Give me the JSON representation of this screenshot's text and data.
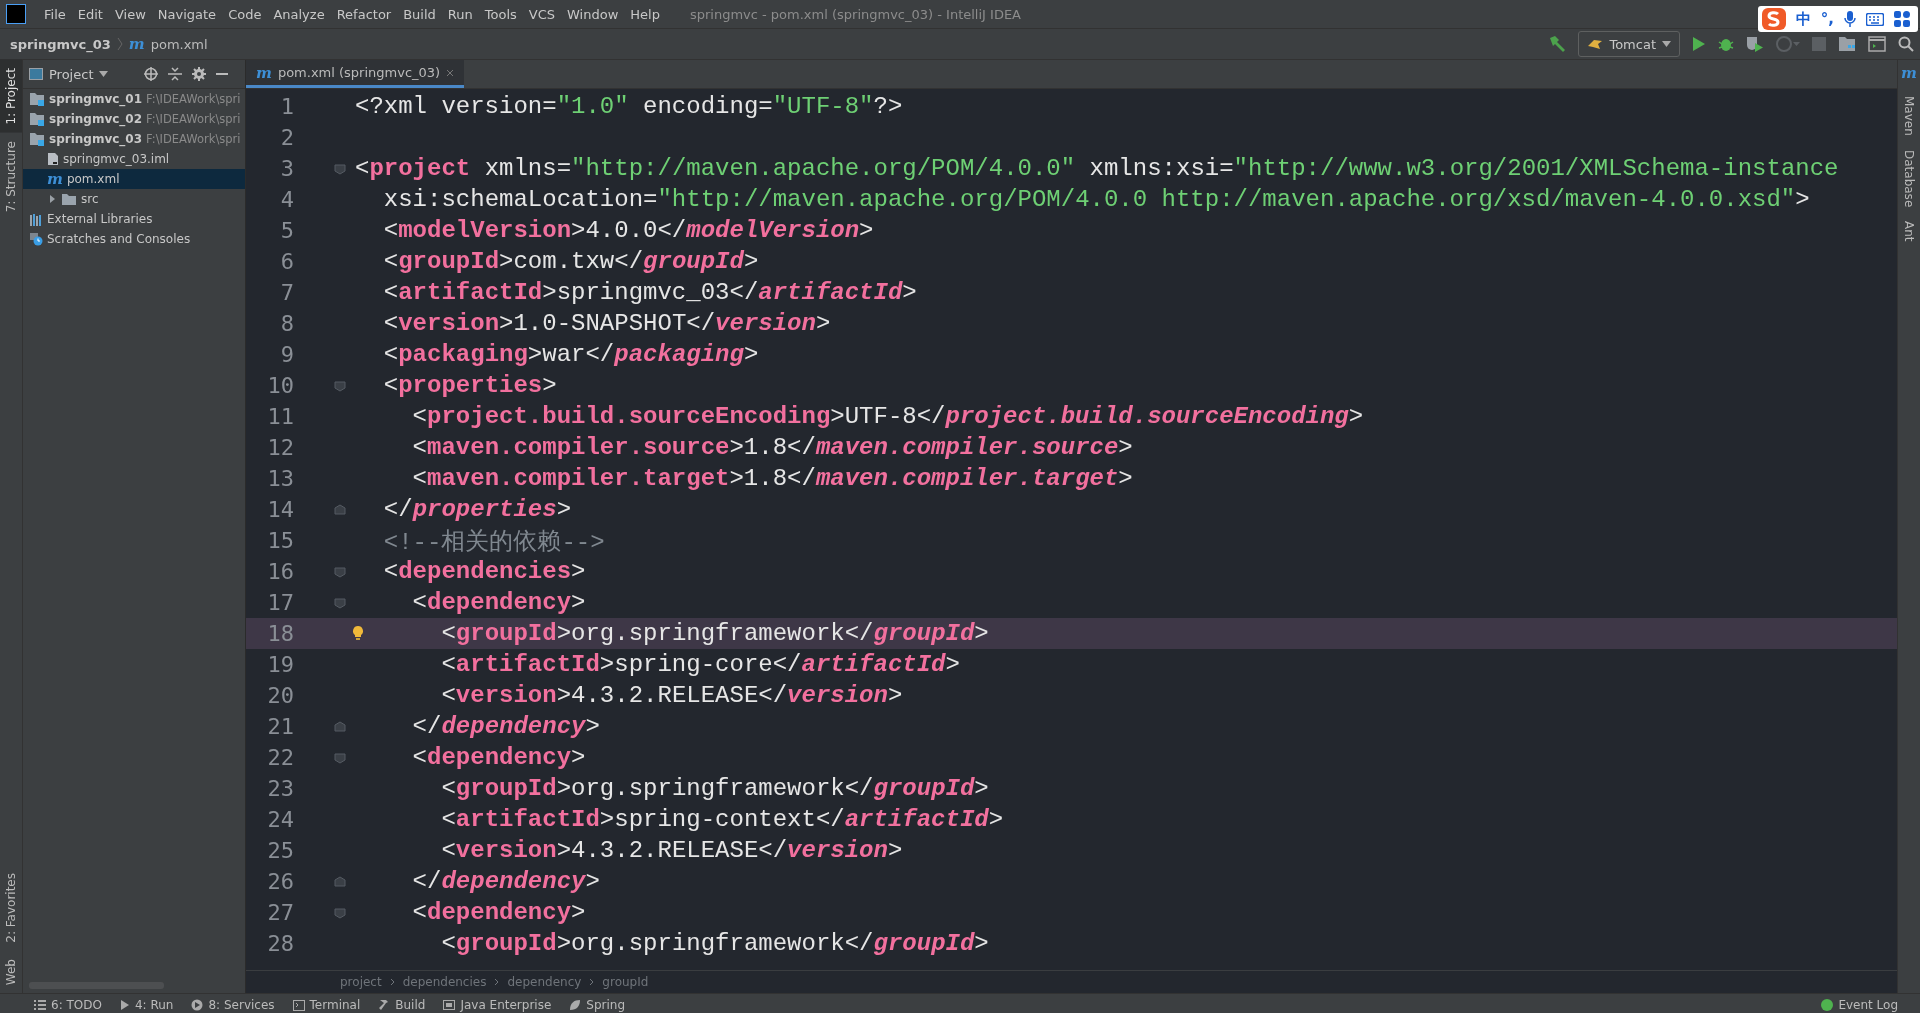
{
  "menu": [
    "File",
    "Edit",
    "View",
    "Navigate",
    "Code",
    "Analyze",
    "Refactor",
    "Build",
    "Run",
    "Tools",
    "VCS",
    "Window",
    "Help"
  ],
  "window": {
    "title": "springmvc - pom.xml (springmvc_03) - IntelliJ IDEA"
  },
  "navbar": {
    "project": "springmvc_03",
    "file_badge": "m",
    "file": "pom.xml"
  },
  "run_config": {
    "label": "Tomcat"
  },
  "ime": {
    "items": [
      "中",
      "°,"
    ]
  },
  "left_strip": {
    "top": [
      {
        "label": "1: Project",
        "selected": true
      },
      {
        "label": "7: Structure",
        "selected": false
      }
    ],
    "bottom": [
      {
        "label": "2: Favorites",
        "selected": false
      },
      {
        "label": "Web",
        "selected": false
      }
    ]
  },
  "right_strip": {
    "badge": "m",
    "tabs": [
      "Maven",
      "Database",
      "Ant"
    ]
  },
  "project_panel": {
    "title": "Project",
    "tree": [
      {
        "kind": "module",
        "label": "springmvc_01",
        "path": "F:\\IDEAWork\\spri",
        "selected": false
      },
      {
        "kind": "module",
        "label": "springmvc_02",
        "path": "F:\\IDEAWork\\spri",
        "selected": false
      },
      {
        "kind": "module",
        "label": "springmvc_03",
        "path": "F:\\IDEAWork\\spri",
        "selected": false,
        "children": [
          {
            "kind": "file",
            "label": "springmvc_03.iml",
            "selected": false
          },
          {
            "kind": "pom",
            "badge": "m",
            "label": "pom.xml",
            "selected": true
          },
          {
            "kind": "folder",
            "label": "src",
            "selected": false,
            "expanded": false
          }
        ]
      },
      {
        "kind": "libraries",
        "label": "External Libraries",
        "selected": false
      },
      {
        "kind": "scratches",
        "label": "Scratches and Consoles",
        "selected": false
      }
    ]
  },
  "editor": {
    "tabs": [
      {
        "badge": "m",
        "label": "pom.xml (springmvc_03)",
        "selected": true
      }
    ],
    "lines": [
      {
        "number": "1",
        "kind": "plain",
        "current": false,
        "segments": [
          {
            "kind": "plain",
            "text": "<?xml version="
          },
          {
            "kind": "string",
            "text": "\"1.0\""
          },
          {
            "kind": "plain",
            "text": " encoding="
          },
          {
            "kind": "string",
            "text": "\"UTF-8\""
          },
          {
            "kind": "plain",
            "text": "?>"
          }
        ]
      },
      {
        "number": "2",
        "kind": "plain",
        "current": false
      },
      {
        "number": "3",
        "kind": "fold-start",
        "current": false,
        "segments": [
          {
            "kind": "plain",
            "text": "<"
          },
          {
            "kind": "tag",
            "text": "project"
          },
          {
            "kind": "plain",
            "text": " xmlns="
          },
          {
            "kind": "string",
            "text": "\"http://maven.apache.org/POM/4.0.0\""
          },
          {
            "kind": "plain",
            "text": " xmlns:xsi="
          },
          {
            "kind": "string",
            "text": "\"http://www.w3.org/2001/XMLSchema-instance"
          }
        ]
      },
      {
        "number": "4",
        "kind": "plain",
        "current": false,
        "segments": [
          {
            "kind": "plain",
            "text": "  xsi:schemaLocation="
          },
          {
            "kind": "string",
            "text": "\"http://maven.apache.org/POM/4.0.0 http://maven.apache.org/xsd/maven-4.0.0.xsd\""
          },
          {
            "kind": "plain",
            "text": ">"
          }
        ]
      },
      {
        "number": "5",
        "kind": "plain",
        "current": false,
        "segments": [
          {
            "kind": "plain",
            "text": "  <"
          },
          {
            "kind": "tag",
            "text": "modelVersion"
          },
          {
            "kind": "plain",
            "text": ">4.0.0</"
          },
          {
            "kind": "end-tag",
            "text": "modelVersion"
          },
          {
            "kind": "plain",
            "text": ">"
          }
        ]
      },
      {
        "number": "6",
        "kind": "plain",
        "current": false,
        "segments": [
          {
            "kind": "plain",
            "text": "  <"
          },
          {
            "kind": "tag",
            "text": "groupId"
          },
          {
            "kind": "plain",
            "text": ">com.txw</"
          },
          {
            "kind": "end-tag",
            "text": "groupId"
          },
          {
            "kind": "plain",
            "text": ">"
          }
        ]
      },
      {
        "number": "7",
        "kind": "plain",
        "current": false,
        "segments": [
          {
            "kind": "plain",
            "text": "  <"
          },
          {
            "kind": "tag",
            "text": "artifactId"
          },
          {
            "kind": "plain",
            "text": ">springmvc_03</"
          },
          {
            "kind": "end-tag",
            "text": "artifactId"
          },
          {
            "kind": "plain",
            "text": ">"
          }
        ]
      },
      {
        "number": "8",
        "kind": "plain",
        "current": false,
        "segments": [
          {
            "kind": "plain",
            "text": "  <"
          },
          {
            "kind": "tag",
            "text": "version"
          },
          {
            "kind": "plain",
            "text": ">1.0-SNAPSHOT</"
          },
          {
            "kind": "end-tag",
            "text": "version"
          },
          {
            "kind": "plain",
            "text": ">"
          }
        ]
      },
      {
        "number": "9",
        "kind": "plain",
        "current": false,
        "segments": [
          {
            "kind": "plain",
            "text": "  <"
          },
          {
            "kind": "tag",
            "text": "packaging"
          },
          {
            "kind": "plain",
            "text": ">war</"
          },
          {
            "kind": "end-tag",
            "text": "packaging"
          },
          {
            "kind": "plain",
            "text": ">"
          }
        ]
      },
      {
        "number": "10",
        "kind": "fold-start",
        "current": false,
        "segments": [
          {
            "kind": "plain",
            "text": "  <"
          },
          {
            "kind": "tag",
            "text": "properties"
          },
          {
            "kind": "plain",
            "text": ">"
          }
        ]
      },
      {
        "number": "11",
        "kind": "plain",
        "current": false,
        "segments": [
          {
            "kind": "plain",
            "text": "    <"
          },
          {
            "kind": "tag",
            "text": "project.build.sourceEncoding"
          },
          {
            "kind": "plain",
            "text": ">UTF-8</"
          },
          {
            "kind": "end-tag",
            "text": "project.build.sourceEncoding"
          },
          {
            "kind": "plain",
            "text": ">"
          }
        ]
      },
      {
        "number": "12",
        "kind": "plain",
        "current": false,
        "segments": [
          {
            "kind": "plain",
            "text": "    <"
          },
          {
            "kind": "tag",
            "text": "maven.compiler.source"
          },
          {
            "kind": "plain",
            "text": ">1.8</"
          },
          {
            "kind": "end-tag",
            "text": "maven.compiler.source"
          },
          {
            "kind": "plain",
            "text": ">"
          }
        ]
      },
      {
        "number": "13",
        "kind": "plain",
        "current": false,
        "segments": [
          {
            "kind": "plain",
            "text": "    <"
          },
          {
            "kind": "tag",
            "text": "maven.compiler.target"
          },
          {
            "kind": "plain",
            "text": ">1.8</"
          },
          {
            "kind": "end-tag",
            "text": "maven.compiler.target"
          },
          {
            "kind": "plain",
            "text": ">"
          }
        ]
      },
      {
        "number": "14",
        "kind": "fold-end",
        "current": false,
        "segments": [
          {
            "kind": "plain",
            "text": "  </"
          },
          {
            "kind": "end-tag",
            "text": "properties"
          },
          {
            "kind": "plain",
            "text": ">"
          }
        ]
      },
      {
        "number": "15",
        "kind": "plain",
        "current": false,
        "segments": [
          {
            "kind": "comment",
            "text": "  <!--相关的依赖-->"
          }
        ]
      },
      {
        "number": "16",
        "kind": "fold-start",
        "current": false,
        "segments": [
          {
            "kind": "plain",
            "text": "  <"
          },
          {
            "kind": "tag",
            "text": "dependencies"
          },
          {
            "kind": "plain",
            "text": ">"
          }
        ]
      },
      {
        "number": "17",
        "kind": "fold-start",
        "current": false,
        "segments": [
          {
            "kind": "plain",
            "text": "    <"
          },
          {
            "kind": "tag",
            "text": "dependency"
          },
          {
            "kind": "plain",
            "text": ">"
          }
        ]
      },
      {
        "number": "18",
        "kind": "bulb",
        "current": true,
        "segments": [
          {
            "kind": "plain",
            "text": "      <"
          },
          {
            "kind": "tag",
            "text": "groupId"
          },
          {
            "kind": "plain",
            "text": ">org.springframework</"
          },
          {
            "kind": "end-tag",
            "text": "groupId"
          },
          {
            "kind": "plain",
            "text": ">"
          }
        ]
      },
      {
        "number": "19",
        "kind": "plain",
        "current": false,
        "segments": [
          {
            "kind": "plain",
            "text": "      <"
          },
          {
            "kind": "tag",
            "text": "artifactId"
          },
          {
            "kind": "plain",
            "text": ">spring-core</"
          },
          {
            "kind": "end-tag",
            "text": "artifactId"
          },
          {
            "kind": "plain",
            "text": ">"
          }
        ]
      },
      {
        "number": "20",
        "kind": "plain",
        "current": false,
        "segments": [
          {
            "kind": "plain",
            "text": "      <"
          },
          {
            "kind": "tag",
            "text": "version"
          },
          {
            "kind": "plain",
            "text": ">4.3.2.RELEASE</"
          },
          {
            "kind": "end-tag",
            "text": "version"
          },
          {
            "kind": "plain",
            "text": ">"
          }
        ]
      },
      {
        "number": "21",
        "kind": "fold-end",
        "current": false,
        "segments": [
          {
            "kind": "plain",
            "text": "    </"
          },
          {
            "kind": "end-tag",
            "text": "dependency"
          },
          {
            "kind": "plain",
            "text": ">"
          }
        ]
      },
      {
        "number": "22",
        "kind": "fold-start",
        "current": false,
        "segments": [
          {
            "kind": "plain",
            "text": "    <"
          },
          {
            "kind": "tag",
            "text": "dependency"
          },
          {
            "kind": "plain",
            "text": ">"
          }
        ]
      },
      {
        "number": "23",
        "kind": "plain",
        "current": false,
        "segments": [
          {
            "kind": "plain",
            "text": "      <"
          },
          {
            "kind": "tag",
            "text": "groupId"
          },
          {
            "kind": "plain",
            "text": ">org.springframework</"
          },
          {
            "kind": "end-tag",
            "text": "groupId"
          },
          {
            "kind": "plain",
            "text": ">"
          }
        ]
      },
      {
        "number": "24",
        "kind": "plain",
        "current": false,
        "segments": [
          {
            "kind": "plain",
            "text": "      <"
          },
          {
            "kind": "tag",
            "text": "artifactId"
          },
          {
            "kind": "plain",
            "text": ">spring-context</"
          },
          {
            "kind": "end-tag",
            "text": "artifactId"
          },
          {
            "kind": "plain",
            "text": ">"
          }
        ]
      },
      {
        "number": "25",
        "kind": "plain",
        "current": false,
        "segments": [
          {
            "kind": "plain",
            "text": "      <"
          },
          {
            "kind": "tag",
            "text": "version"
          },
          {
            "kind": "plain",
            "text": ">4.3.2.RELEASE</"
          },
          {
            "kind": "end-tag",
            "text": "version"
          },
          {
            "kind": "plain",
            "text": ">"
          }
        ]
      },
      {
        "number": "26",
        "kind": "fold-end",
        "current": false,
        "segments": [
          {
            "kind": "plain",
            "text": "    </"
          },
          {
            "kind": "end-tag",
            "text": "dependency"
          },
          {
            "kind": "plain",
            "text": ">"
          }
        ]
      },
      {
        "number": "27",
        "kind": "fold-start",
        "current": false,
        "segments": [
          {
            "kind": "plain",
            "text": "    <"
          },
          {
            "kind": "tag",
            "text": "dependency"
          },
          {
            "kind": "plain",
            "text": ">"
          }
        ]
      },
      {
        "number": "28",
        "kind": "plain",
        "current": false,
        "segments": [
          {
            "kind": "plain",
            "text": "      <"
          },
          {
            "kind": "tag",
            "text": "groupId"
          },
          {
            "kind": "plain",
            "text": ">org.springframework</"
          },
          {
            "kind": "end-tag",
            "text": "groupId"
          },
          {
            "kind": "plain",
            "text": ">"
          }
        ]
      }
    ],
    "breadcrumbs": [
      "project",
      "dependencies",
      "dependency",
      "groupId"
    ]
  },
  "bottom_bar": {
    "tools": [
      {
        "kind": "list",
        "label": "6: TODO"
      },
      {
        "kind": "run",
        "label": "4: Run"
      },
      {
        "kind": "services",
        "label": "8: Services"
      },
      {
        "kind": "terminal",
        "label": "Terminal"
      },
      {
        "kind": "build",
        "label": "Build"
      },
      {
        "kind": "enterprise",
        "label": "Java Enterprise"
      },
      {
        "kind": "spring",
        "label": "Spring"
      }
    ],
    "event_log": "Event Log"
  }
}
